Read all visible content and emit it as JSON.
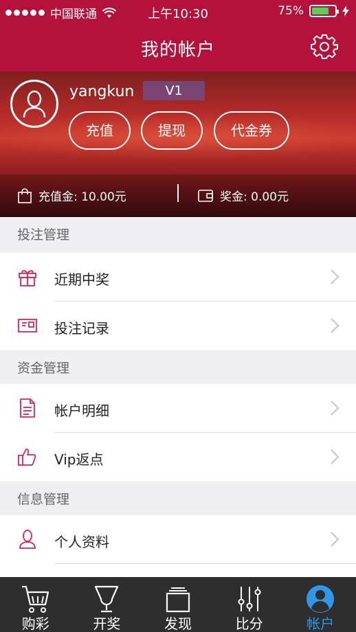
{
  "status_bar": {
    "carrier": "中国联通",
    "time": "上午10:30",
    "battery": "75%"
  },
  "header": {
    "title": "我的帐户"
  },
  "profile": {
    "username": "yangkun",
    "level": "V1",
    "buttons": [
      "充值",
      "提现",
      "代金券"
    ],
    "balance_label": "充值金: 10.00元",
    "bonus_label": "奖金: 0.00元"
  },
  "sections": [
    {
      "title": "投注管理",
      "items": [
        {
          "label": "近期中奖",
          "icon": "gift-icon"
        },
        {
          "label": "投注记录",
          "icon": "ticket-icon"
        }
      ]
    },
    {
      "title": "资金管理",
      "items": [
        {
          "label": "帐户明细",
          "icon": "document-icon"
        },
        {
          "label": "Vip返点",
          "icon": "thumbs-up-icon"
        }
      ]
    },
    {
      "title": "信息管理",
      "items": [
        {
          "label": "个人资料",
          "icon": "person-icon"
        }
      ]
    }
  ],
  "tabbar": {
    "items": [
      {
        "label": "购彩",
        "icon": "cart-icon"
      },
      {
        "label": "开奖",
        "icon": "trophy-icon"
      },
      {
        "label": "发现",
        "icon": "cards-icon"
      },
      {
        "label": "比分",
        "icon": "sliders-icon"
      },
      {
        "label": "帐户",
        "icon": "account-icon"
      }
    ],
    "active": "帐户"
  },
  "colors": {
    "brand": "#b5123b",
    "accent": "#d8235a",
    "tab_active": "#2f98e8",
    "battery": "#58d259"
  }
}
